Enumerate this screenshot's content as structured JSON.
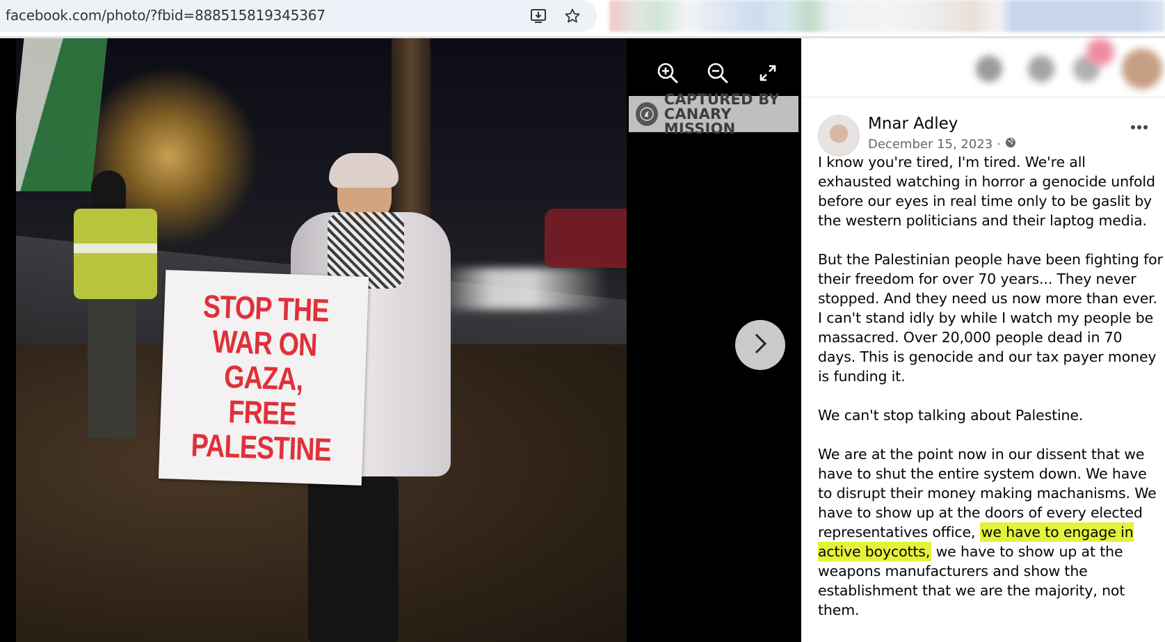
{
  "browser": {
    "url": "facebook.com/photo/?fbid=888515819345367"
  },
  "viewer": {
    "sign_text": "STOP THE\nWAR ON\nGAZA,\nFREE\nPALESTINE",
    "watermark": "CAPTURED BY\nCANARY MISSION",
    "icons": [
      "zoom-in-icon",
      "zoom-out-icon",
      "fullscreen-icon",
      "chevron-right-icon"
    ]
  },
  "post": {
    "author": "Mnar Adley",
    "date": "December 15, 2023 ·",
    "paragraphs": [
      "I know you're tired, I'm tired. We're all exhausted watching in horror a genocide unfold before our eyes in real time only to be gaslit by the western politicians and their laptog media.",
      "But the Palestinian people have been fighting for their freedom for over 70 years... They never stopped. And they need us now more than ever. I can't stand idly by while I watch my people be massacred. Over 20,000 people dead in 70 days. This is genocide and our tax payer money is funding it.",
      "We can't stop talking about Palestine."
    ],
    "p4_before": "We are at the point now in our dissent that we have to shut the entire system down. We have to disrupt their money making machanisms. We have to show up at the doors of every elected representatives office, ",
    "p4_highlight": "we have to engage in active boycotts,",
    "p4_after": " we have to show up at the weapons manufacturers and show the establishment that we are the majority, not them."
  },
  "colors": {
    "highlight": "#e5f23b",
    "sign_text": "#e0303a"
  }
}
